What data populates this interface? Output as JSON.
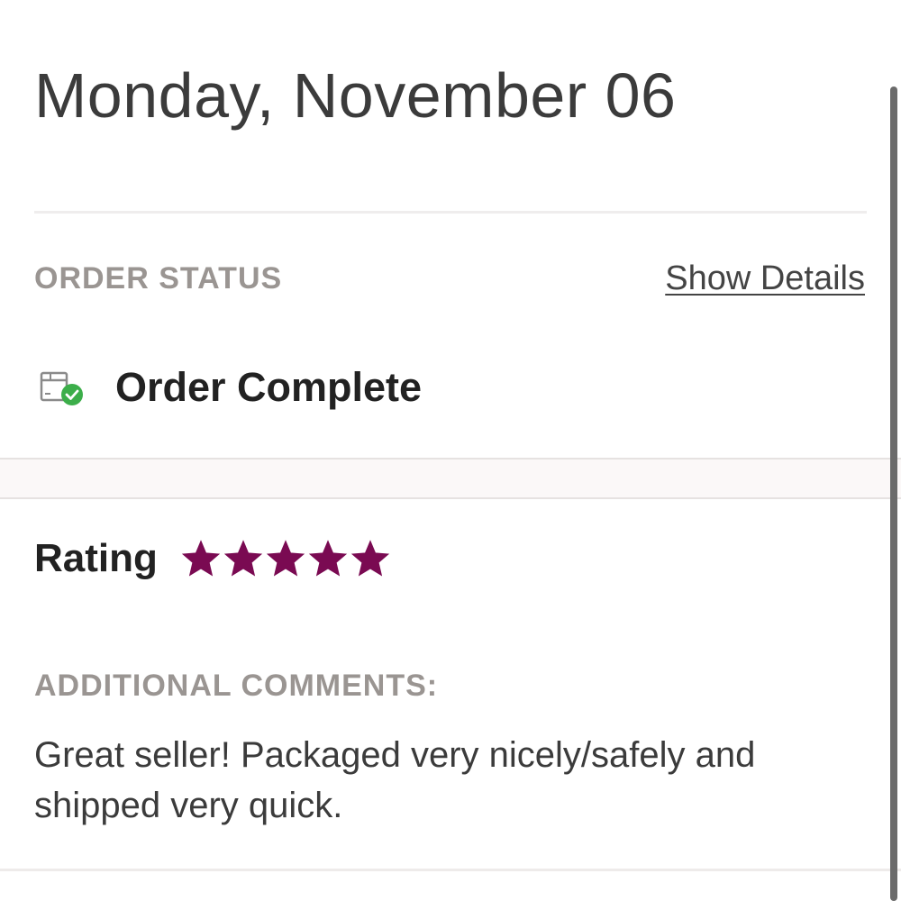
{
  "header": {
    "date": "Monday, November 06"
  },
  "order_status": {
    "label": "ORDER STATUS",
    "details_link": "Show Details",
    "status_text": "Order Complete",
    "status_icon": "package-check-icon",
    "status_icon_color": "#3cae4a"
  },
  "rating": {
    "label": "Rating",
    "stars_filled": 5,
    "stars_total": 5,
    "star_color": "#7a0a52"
  },
  "comments": {
    "label": "ADDITIONAL COMMENTS:",
    "text": "Great seller! Packaged very nicely/safely and shipped very quick."
  }
}
